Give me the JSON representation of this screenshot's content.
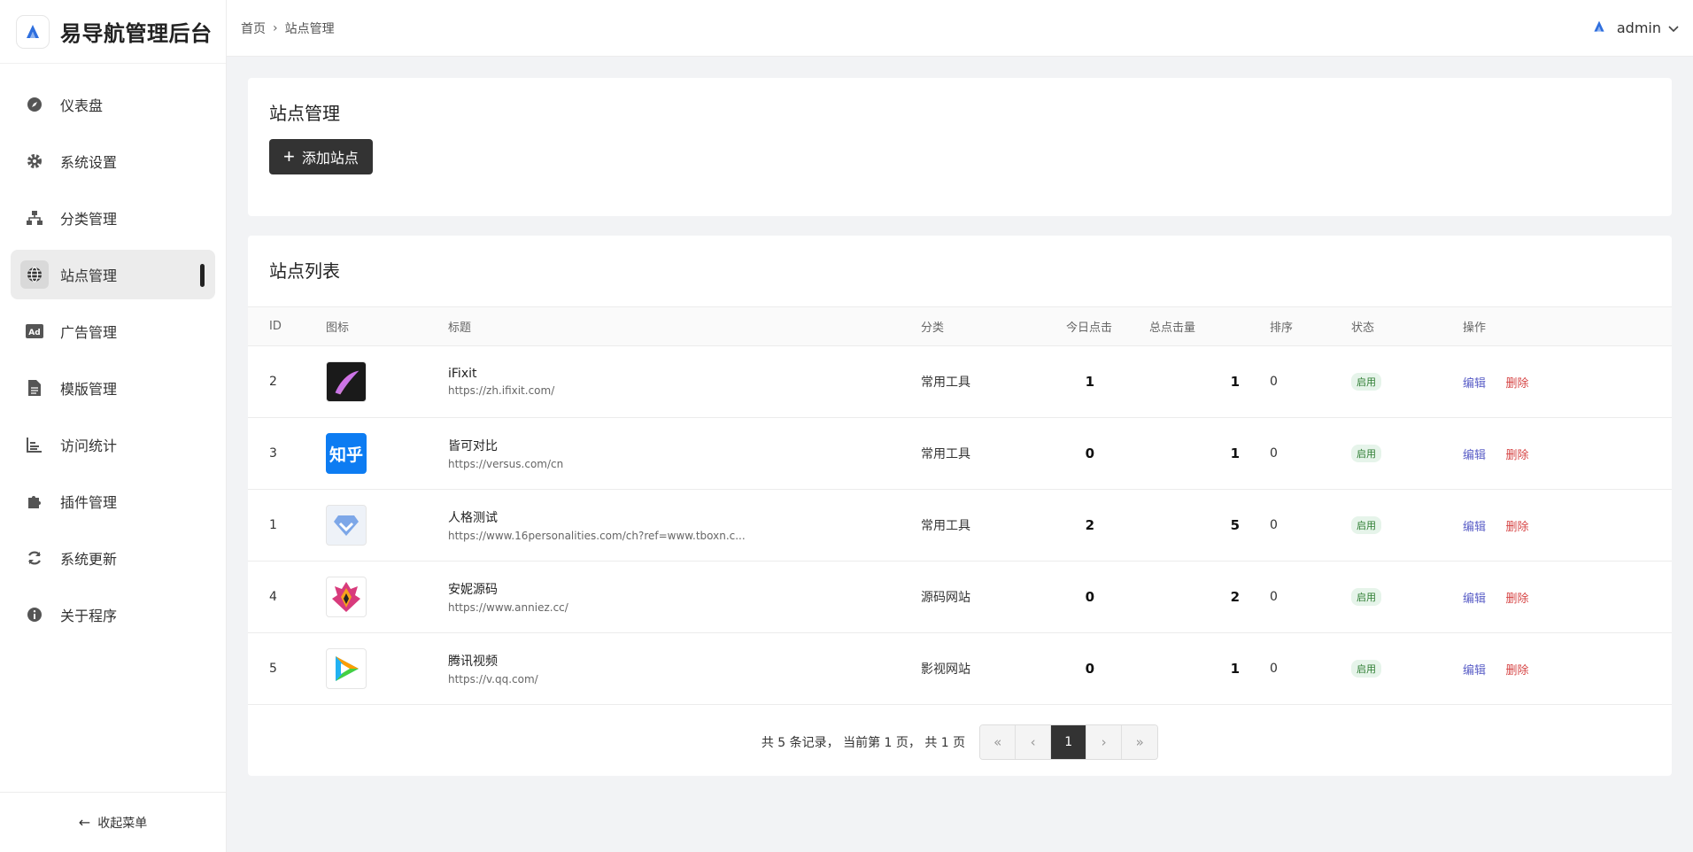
{
  "brand": {
    "title": "易导航管理后台"
  },
  "sidebar": {
    "items": [
      {
        "label": "仪表盘",
        "icon": "compass-icon"
      },
      {
        "label": "系统设置",
        "icon": "gear-icon"
      },
      {
        "label": "分类管理",
        "icon": "sitemap-icon"
      },
      {
        "label": "站点管理",
        "icon": "globe-icon"
      },
      {
        "label": "广告管理",
        "icon": "ad-icon"
      },
      {
        "label": "模版管理",
        "icon": "file-icon"
      },
      {
        "label": "访问统计",
        "icon": "chart-icon"
      },
      {
        "label": "插件管理",
        "icon": "puzzle-icon"
      },
      {
        "label": "系统更新",
        "icon": "refresh-icon"
      },
      {
        "label": "关于程序",
        "icon": "info-icon"
      }
    ],
    "collapse_label": "收起菜单"
  },
  "header": {
    "breadcrumb": [
      "首页",
      "站点管理"
    ],
    "user": "admin"
  },
  "section1": {
    "title": "站点管理",
    "add_label": "添加站点"
  },
  "table": {
    "title": "站点列表",
    "columns": [
      "ID",
      "图标",
      "标题",
      "分类",
      "今日点击",
      "总点击量",
      "排序",
      "状态",
      "操作"
    ],
    "rows": [
      {
        "id": "2",
        "name": "iFixit",
        "url": "https://zh.ifixit.com/",
        "category": "常用工具",
        "today": "1",
        "total": "1",
        "sort": "0",
        "status": "启用",
        "icon": "procreate-logo-icon"
      },
      {
        "id": "3",
        "name": "皆可对比",
        "url": "https://versus.com/cn",
        "category": "常用工具",
        "today": "0",
        "total": "1",
        "sort": "0",
        "status": "启用",
        "icon": "zhihu-logo-icon"
      },
      {
        "id": "1",
        "name": "人格测试",
        "url": "https://www.16personalities.com/ch?ref=www.tboxn.c...",
        "category": "常用工具",
        "today": "2",
        "total": "5",
        "sort": "0",
        "status": "启用",
        "icon": "diamond-logo-icon"
      },
      {
        "id": "4",
        "name": "安妮源码",
        "url": "https://www.anniez.cc/",
        "category": "源码网站",
        "today": "0",
        "total": "2",
        "sort": "0",
        "status": "启用",
        "icon": "phoenix-logo-icon"
      },
      {
        "id": "5",
        "name": "腾讯视频",
        "url": "https://v.qq.com/",
        "category": "影视网站",
        "today": "0",
        "total": "1",
        "sort": "0",
        "status": "启用",
        "icon": "tencent-video-logo-icon"
      }
    ],
    "ops": {
      "edit": "编辑",
      "delete": "删除"
    },
    "zhihu_text": "知乎"
  },
  "pager": {
    "info": "共 5 条记录， 当前第 1 页， 共 1 页",
    "current": "1",
    "first": "«",
    "prev": "‹",
    "next": "›",
    "last": "»"
  }
}
